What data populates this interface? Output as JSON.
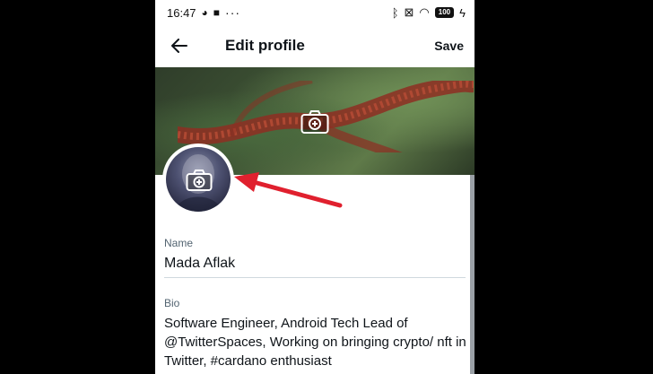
{
  "status_bar": {
    "time": "16:47",
    "battery": "100",
    "icons": [
      "signal-icon",
      "app-icon",
      "video-icon",
      "more-dots-icon",
      "bluetooth-icon",
      "close-box-icon",
      "wifi-icon",
      "battery-icon",
      "charging-icon"
    ]
  },
  "header": {
    "title": "Edit profile",
    "save_label": "Save"
  },
  "profile": {
    "name_label": "Name",
    "name_value": "Mada Aflak",
    "bio_label": "Bio",
    "bio_value": "Software Engineer, Android Tech Lead of @TwitterSpaces, Working on bringing crypto/ nft in Twitter, #cardano enthusiast"
  },
  "colors": {
    "annotation_arrow": "#e0202e",
    "text_primary": "#0f1419",
    "text_secondary": "#536471"
  }
}
